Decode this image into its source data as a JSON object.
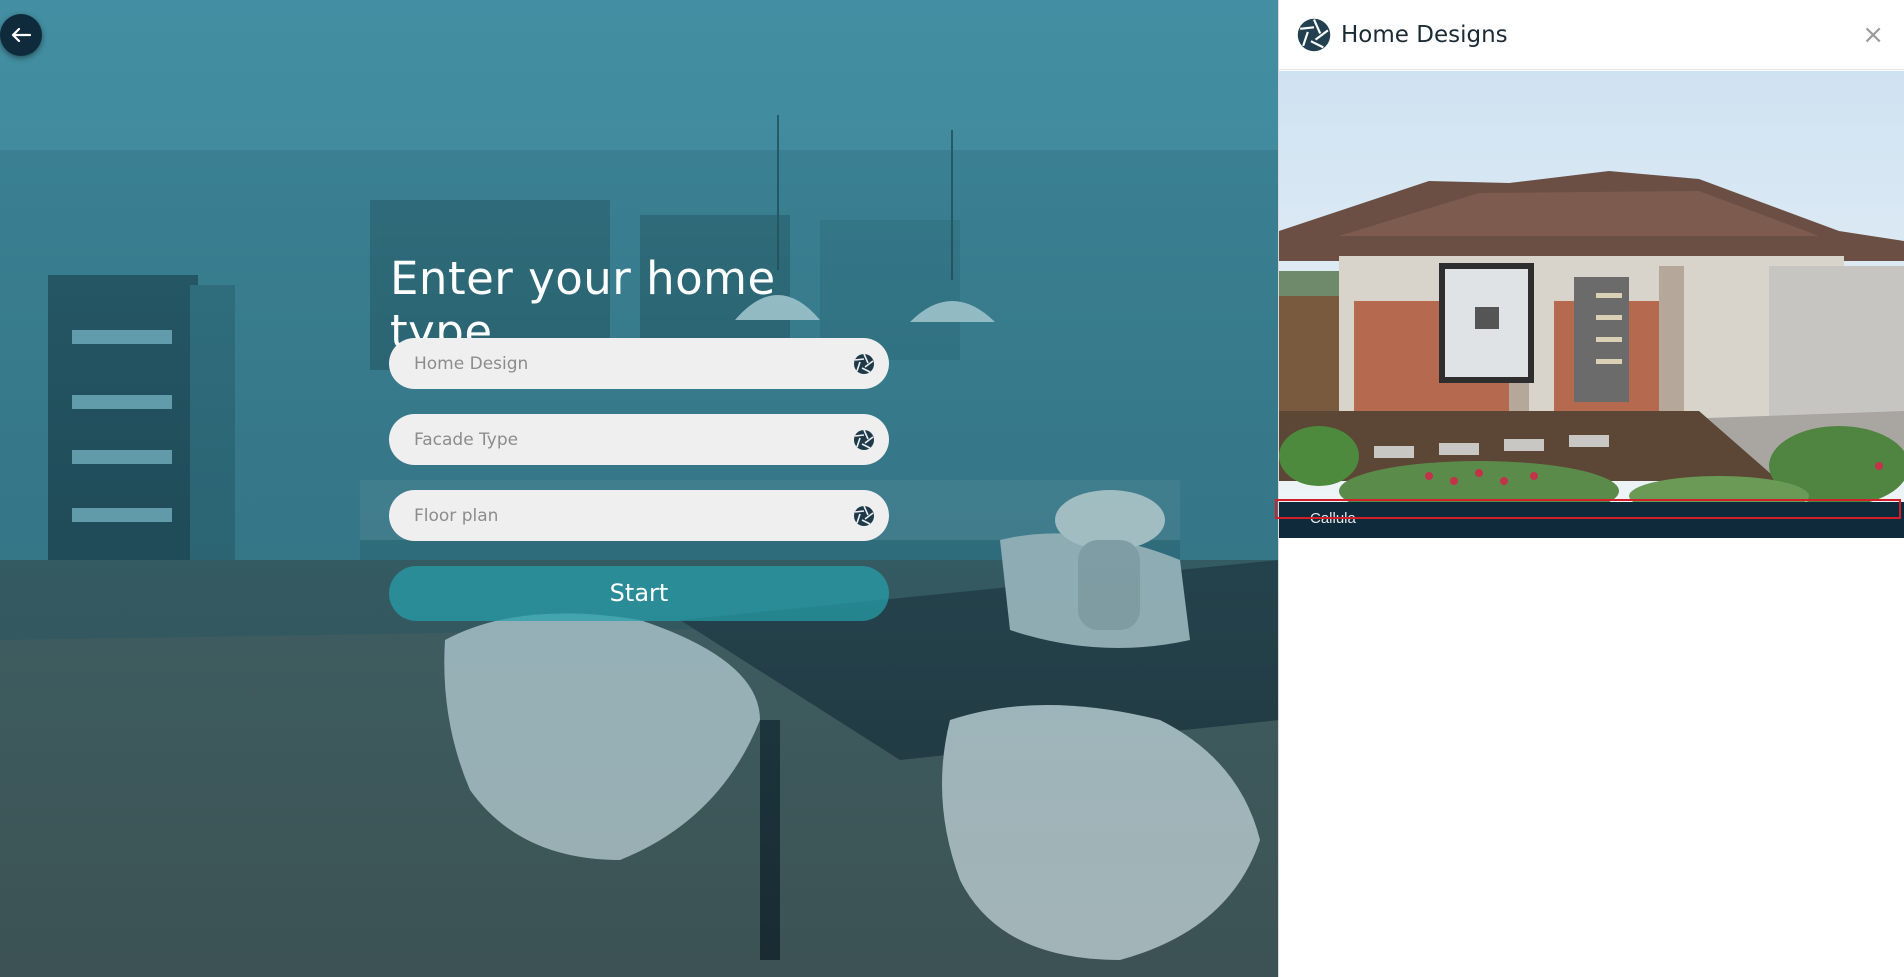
{
  "stage": {
    "back_icon": "arrow-left-icon",
    "heading": "Enter your home type",
    "fields": [
      {
        "placeholder": "Home Design",
        "icon": "aperture-icon"
      },
      {
        "placeholder": "Facade Type",
        "icon": "aperture-icon"
      },
      {
        "placeholder": "Floor plan",
        "icon": "aperture-icon"
      }
    ],
    "start_label": "Start"
  },
  "panel": {
    "logo_icon": "aperture-icon",
    "title": "Home Designs",
    "close_label": "×",
    "designs": [
      {
        "name": "Callula"
      }
    ]
  },
  "colors": {
    "navy": "#0f2a3b",
    "teal_overlay": "#3f8a9e",
    "start_button": "#26a0aa",
    "field_bg": "#efefef",
    "highlight": "#d1202a"
  }
}
